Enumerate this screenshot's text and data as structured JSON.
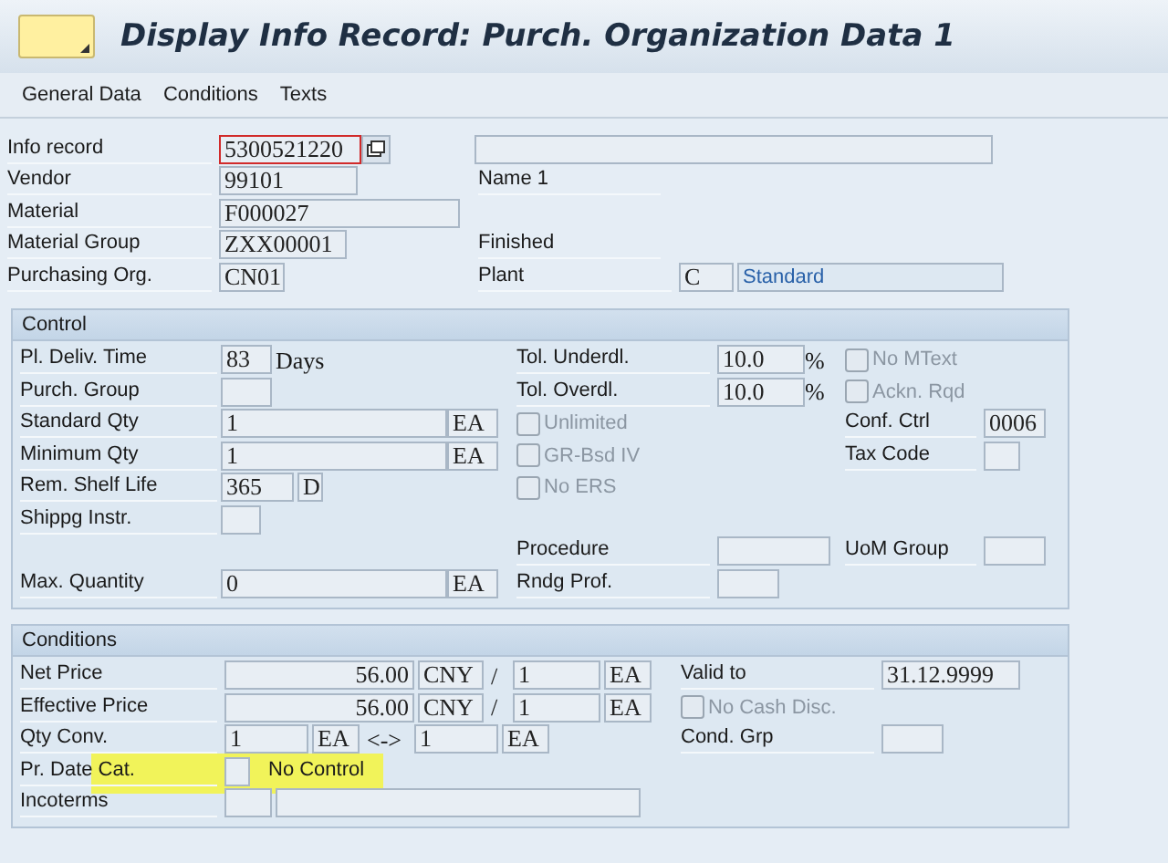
{
  "title": "Display Info Record: Purch. Organization Data 1",
  "menu": [
    {
      "label": "General Data"
    },
    {
      "label": "Conditions"
    },
    {
      "label": "Texts"
    }
  ],
  "header_rows": [
    {
      "items": [
        {
          "kind": "label",
          "text": "Info record"
        },
        {
          "kind": "field",
          "value": "5300521220",
          "focused": true
        },
        {
          "kind": "button"
        },
        {
          "kind": "field",
          "value": ""
        }
      ]
    },
    {
      "items": [
        {
          "kind": "label",
          "text": "Vendor"
        },
        {
          "kind": "field",
          "value": "99101"
        },
        {
          "kind": "label",
          "text": "Name 1"
        }
      ]
    },
    {
      "items": [
        {
          "kind": "label",
          "text": "Material"
        },
        {
          "kind": "field",
          "value": "F000027"
        }
      ]
    },
    {
      "items": [
        {
          "kind": "label",
          "text": "Material Group"
        },
        {
          "kind": "field",
          "value": "ZXX00001"
        },
        {
          "kind": "label",
          "text": "Finished"
        }
      ]
    },
    {
      "items": [
        {
          "kind": "label",
          "text": "Purchasing Org."
        },
        {
          "kind": "field",
          "value": "CN01"
        },
        {
          "kind": "label",
          "text": "Plant"
        },
        {
          "kind": "field",
          "value": "C"
        },
        {
          "kind": "desc",
          "value": "Standard"
        }
      ]
    }
  ],
  "sections": [
    {
      "title": "Control",
      "rows": [
        {
          "items": [
            {
              "kind": "label",
              "text": "Pl. Deliv. Time"
            },
            {
              "kind": "field",
              "value": "83"
            },
            {
              "kind": "text",
              "text": "Days"
            },
            {
              "kind": "label",
              "text": "Tol. Underdl."
            },
            {
              "kind": "field",
              "value": "10.0"
            },
            {
              "kind": "text",
              "text": "%"
            },
            {
              "kind": "checkbox",
              "label": "No MText",
              "checked": false,
              "disabled": true
            }
          ]
        },
        {
          "items": [
            {
              "kind": "label",
              "text": "Purch. Group"
            },
            {
              "kind": "field",
              "value": ""
            },
            {
              "kind": "label",
              "text": "Tol. Overdl."
            },
            {
              "kind": "field",
              "value": "10.0"
            },
            {
              "kind": "text",
              "text": "%"
            },
            {
              "kind": "checkbox",
              "label": "Ackn. Rqd",
              "checked": false,
              "disabled": true
            }
          ]
        },
        {
          "items": [
            {
              "kind": "label",
              "text": "Standard Qty"
            },
            {
              "kind": "field",
              "value": "1"
            },
            {
              "kind": "field",
              "value": "EA"
            },
            {
              "kind": "checkbox",
              "label": "Unlimited",
              "checked": false,
              "disabled": true
            },
            {
              "kind": "label",
              "text": "Conf. Ctrl"
            },
            {
              "kind": "field",
              "value": "0006"
            }
          ]
        },
        {
          "items": [
            {
              "kind": "label",
              "text": "Minimum Qty"
            },
            {
              "kind": "field",
              "value": "1"
            },
            {
              "kind": "field",
              "value": "EA"
            },
            {
              "kind": "checkbox",
              "label": "GR-Bsd IV",
              "checked": false,
              "disabled": true
            },
            {
              "kind": "label",
              "text": "Tax Code"
            },
            {
              "kind": "field",
              "value": ""
            }
          ]
        },
        {
          "items": [
            {
              "kind": "label",
              "text": "Rem. Shelf Life"
            },
            {
              "kind": "field",
              "value": "365"
            },
            {
              "kind": "field",
              "value": "D"
            },
            {
              "kind": "checkbox",
              "label": "No ERS",
              "checked": false,
              "disabled": true
            }
          ]
        },
        {
          "items": [
            {
              "kind": "label",
              "text": "Shippg Instr."
            },
            {
              "kind": "field",
              "value": ""
            }
          ]
        },
        {
          "items": [
            {
              "kind": "label",
              "text": "Procedure"
            },
            {
              "kind": "field",
              "value": ""
            },
            {
              "kind": "label",
              "text": "UoM Group"
            },
            {
              "kind": "field",
              "value": ""
            }
          ]
        },
        {
          "items": [
            {
              "kind": "label",
              "text": "Max. Quantity"
            },
            {
              "kind": "field",
              "value": "0"
            },
            {
              "kind": "field",
              "value": "EA"
            },
            {
              "kind": "label",
              "text": "Rndg Prof."
            },
            {
              "kind": "field",
              "value": ""
            }
          ]
        }
      ]
    },
    {
      "title": "Conditions",
      "rows": [
        {
          "items": [
            {
              "kind": "label",
              "text": "Net Price"
            },
            {
              "kind": "field",
              "value": "56.00"
            },
            {
              "kind": "field",
              "value": "CNY"
            },
            {
              "kind": "text",
              "text": "/"
            },
            {
              "kind": "field",
              "value": "1"
            },
            {
              "kind": "field",
              "value": "EA"
            },
            {
              "kind": "label",
              "text": "Valid to"
            },
            {
              "kind": "field",
              "value": "31.12.9999"
            }
          ]
        },
        {
          "items": [
            {
              "kind": "label",
              "text": "Effective Price"
            },
            {
              "kind": "field",
              "value": "56.00"
            },
            {
              "kind": "field",
              "value": "CNY"
            },
            {
              "kind": "text",
              "text": "/"
            },
            {
              "kind": "field",
              "value": "1"
            },
            {
              "kind": "field",
              "value": "EA"
            },
            {
              "kind": "checkbox",
              "label": "No Cash Disc.",
              "checked": false,
              "disabled": true
            }
          ]
        },
        {
          "items": [
            {
              "kind": "label",
              "text": "Qty Conv."
            },
            {
              "kind": "field",
              "value": "1"
            },
            {
              "kind": "field",
              "value": "EA"
            },
            {
              "kind": "text",
              "text": "<->"
            },
            {
              "kind": "field",
              "value": "1"
            },
            {
              "kind": "field",
              "value": "EA"
            },
            {
              "kind": "label",
              "text": "Cond. Grp"
            },
            {
              "kind": "field",
              "value": ""
            }
          ]
        },
        {
          "highlighted": true,
          "items": [
            {
              "kind": "label",
              "text": "Pr. Date Cat."
            },
            {
              "kind": "field",
              "value": ""
            },
            {
              "kind": "text",
              "text": "No Control"
            }
          ]
        },
        {
          "items": [
            {
              "kind": "label",
              "text": "Incoterms"
            },
            {
              "kind": "field",
              "value": ""
            },
            {
              "kind": "field",
              "value": ""
            }
          ]
        }
      ]
    }
  ]
}
